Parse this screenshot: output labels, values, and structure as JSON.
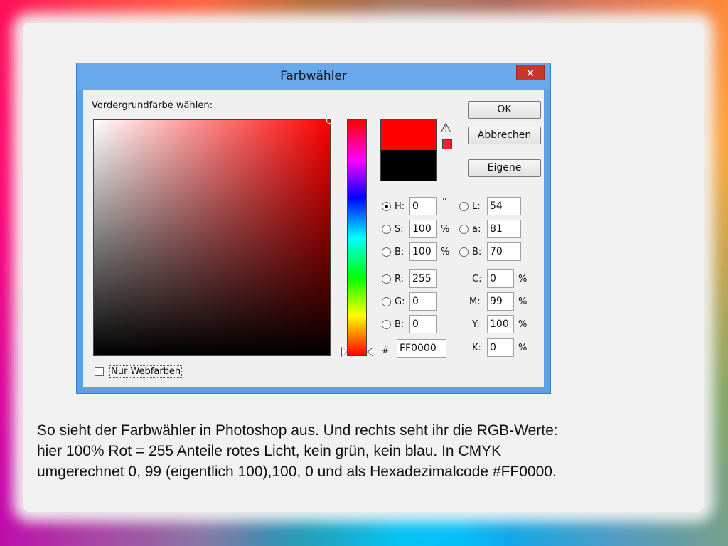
{
  "dialog": {
    "title": "Farbwähler",
    "close_label": "✕",
    "picker_label": "Vordergrundfarbe wählen:",
    "new_color": "#ff0000",
    "old_color": "#000000",
    "gamut_color": "#e8262b",
    "warning_icon": "warning-triangle-icon",
    "buttons": {
      "ok": "OK",
      "cancel": "Abbrechen",
      "custom": "Eigene"
    },
    "hsb": {
      "h_label": "H:",
      "h_value": "0",
      "h_unit": "°",
      "s_label": "S:",
      "s_value": "100",
      "s_unit": "%",
      "b_label": "B:",
      "b_value": "100",
      "b_unit": "%"
    },
    "rgb": {
      "r_label": "R:",
      "r_value": "255",
      "g_label": "G:",
      "g_value": "0",
      "b_label": "B:",
      "b_value": "0"
    },
    "lab": {
      "l_label": "L:",
      "l_value": "54",
      "a_label": "a:",
      "a_value": "81",
      "b_label": "B:",
      "b_value": "70"
    },
    "cmyk": {
      "c_label": "C:",
      "c_value": "0",
      "c_unit": "%",
      "m_label": "M:",
      "m_value": "99",
      "m_unit": "%",
      "y_label": "Y:",
      "y_value": "100",
      "y_unit": "%",
      "k_label": "K:",
      "k_value": "0",
      "k_unit": "%"
    },
    "hex_label": "#",
    "hex_value": "FF0000",
    "webcolors_label": "Nur Webfarben"
  },
  "caption": {
    "line1": "So sieht der Farbwähler in Photoshop aus. Und rechts seht ihr die RGB-Werte:",
    "line2": "hier 100% Rot = 255 Anteile rotes Licht, kein grün, kein blau. In CMYK",
    "line3": "umgerechnet 0, 99 (eigentlich 100),100, 0 und als Hexadezimalcode #FF0000."
  }
}
